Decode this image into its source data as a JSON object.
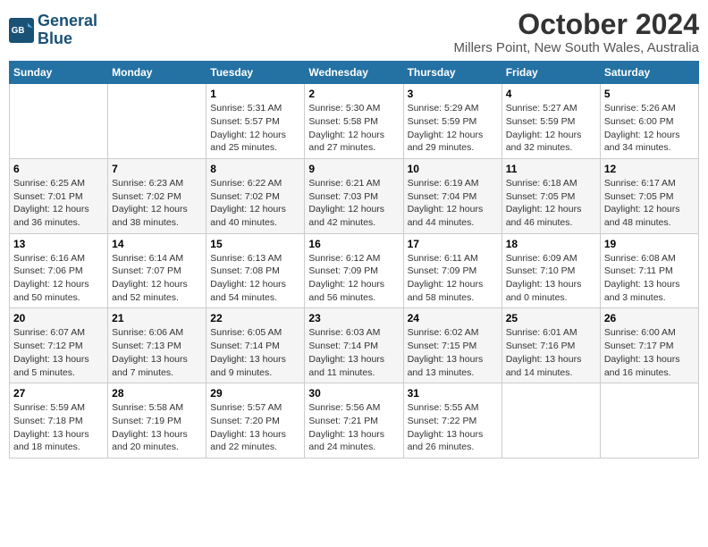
{
  "logo": {
    "line1": "General",
    "line2": "Blue"
  },
  "title": "October 2024",
  "subtitle": "Millers Point, New South Wales, Australia",
  "days_of_week": [
    "Sunday",
    "Monday",
    "Tuesday",
    "Wednesday",
    "Thursday",
    "Friday",
    "Saturday"
  ],
  "weeks": [
    [
      {
        "day": "",
        "sunrise": "",
        "sunset": "",
        "daylight": ""
      },
      {
        "day": "",
        "sunrise": "",
        "sunset": "",
        "daylight": ""
      },
      {
        "day": "1",
        "sunrise": "Sunrise: 5:31 AM",
        "sunset": "Sunset: 5:57 PM",
        "daylight": "Daylight: 12 hours and 25 minutes."
      },
      {
        "day": "2",
        "sunrise": "Sunrise: 5:30 AM",
        "sunset": "Sunset: 5:58 PM",
        "daylight": "Daylight: 12 hours and 27 minutes."
      },
      {
        "day": "3",
        "sunrise": "Sunrise: 5:29 AM",
        "sunset": "Sunset: 5:59 PM",
        "daylight": "Daylight: 12 hours and 29 minutes."
      },
      {
        "day": "4",
        "sunrise": "Sunrise: 5:27 AM",
        "sunset": "Sunset: 5:59 PM",
        "daylight": "Daylight: 12 hours and 32 minutes."
      },
      {
        "day": "5",
        "sunrise": "Sunrise: 5:26 AM",
        "sunset": "Sunset: 6:00 PM",
        "daylight": "Daylight: 12 hours and 34 minutes."
      }
    ],
    [
      {
        "day": "6",
        "sunrise": "Sunrise: 6:25 AM",
        "sunset": "Sunset: 7:01 PM",
        "daylight": "Daylight: 12 hours and 36 minutes."
      },
      {
        "day": "7",
        "sunrise": "Sunrise: 6:23 AM",
        "sunset": "Sunset: 7:02 PM",
        "daylight": "Daylight: 12 hours and 38 minutes."
      },
      {
        "day": "8",
        "sunrise": "Sunrise: 6:22 AM",
        "sunset": "Sunset: 7:02 PM",
        "daylight": "Daylight: 12 hours and 40 minutes."
      },
      {
        "day": "9",
        "sunrise": "Sunrise: 6:21 AM",
        "sunset": "Sunset: 7:03 PM",
        "daylight": "Daylight: 12 hours and 42 minutes."
      },
      {
        "day": "10",
        "sunrise": "Sunrise: 6:19 AM",
        "sunset": "Sunset: 7:04 PM",
        "daylight": "Daylight: 12 hours and 44 minutes."
      },
      {
        "day": "11",
        "sunrise": "Sunrise: 6:18 AM",
        "sunset": "Sunset: 7:05 PM",
        "daylight": "Daylight: 12 hours and 46 minutes."
      },
      {
        "day": "12",
        "sunrise": "Sunrise: 6:17 AM",
        "sunset": "Sunset: 7:05 PM",
        "daylight": "Daylight: 12 hours and 48 minutes."
      }
    ],
    [
      {
        "day": "13",
        "sunrise": "Sunrise: 6:16 AM",
        "sunset": "Sunset: 7:06 PM",
        "daylight": "Daylight: 12 hours and 50 minutes."
      },
      {
        "day": "14",
        "sunrise": "Sunrise: 6:14 AM",
        "sunset": "Sunset: 7:07 PM",
        "daylight": "Daylight: 12 hours and 52 minutes."
      },
      {
        "day": "15",
        "sunrise": "Sunrise: 6:13 AM",
        "sunset": "Sunset: 7:08 PM",
        "daylight": "Daylight: 12 hours and 54 minutes."
      },
      {
        "day": "16",
        "sunrise": "Sunrise: 6:12 AM",
        "sunset": "Sunset: 7:09 PM",
        "daylight": "Daylight: 12 hours and 56 minutes."
      },
      {
        "day": "17",
        "sunrise": "Sunrise: 6:11 AM",
        "sunset": "Sunset: 7:09 PM",
        "daylight": "Daylight: 12 hours and 58 minutes."
      },
      {
        "day": "18",
        "sunrise": "Sunrise: 6:09 AM",
        "sunset": "Sunset: 7:10 PM",
        "daylight": "Daylight: 13 hours and 0 minutes."
      },
      {
        "day": "19",
        "sunrise": "Sunrise: 6:08 AM",
        "sunset": "Sunset: 7:11 PM",
        "daylight": "Daylight: 13 hours and 3 minutes."
      }
    ],
    [
      {
        "day": "20",
        "sunrise": "Sunrise: 6:07 AM",
        "sunset": "Sunset: 7:12 PM",
        "daylight": "Daylight: 13 hours and 5 minutes."
      },
      {
        "day": "21",
        "sunrise": "Sunrise: 6:06 AM",
        "sunset": "Sunset: 7:13 PM",
        "daylight": "Daylight: 13 hours and 7 minutes."
      },
      {
        "day": "22",
        "sunrise": "Sunrise: 6:05 AM",
        "sunset": "Sunset: 7:14 PM",
        "daylight": "Daylight: 13 hours and 9 minutes."
      },
      {
        "day": "23",
        "sunrise": "Sunrise: 6:03 AM",
        "sunset": "Sunset: 7:14 PM",
        "daylight": "Daylight: 13 hours and 11 minutes."
      },
      {
        "day": "24",
        "sunrise": "Sunrise: 6:02 AM",
        "sunset": "Sunset: 7:15 PM",
        "daylight": "Daylight: 13 hours and 13 minutes."
      },
      {
        "day": "25",
        "sunrise": "Sunrise: 6:01 AM",
        "sunset": "Sunset: 7:16 PM",
        "daylight": "Daylight: 13 hours and 14 minutes."
      },
      {
        "day": "26",
        "sunrise": "Sunrise: 6:00 AM",
        "sunset": "Sunset: 7:17 PM",
        "daylight": "Daylight: 13 hours and 16 minutes."
      }
    ],
    [
      {
        "day": "27",
        "sunrise": "Sunrise: 5:59 AM",
        "sunset": "Sunset: 7:18 PM",
        "daylight": "Daylight: 13 hours and 18 minutes."
      },
      {
        "day": "28",
        "sunrise": "Sunrise: 5:58 AM",
        "sunset": "Sunset: 7:19 PM",
        "daylight": "Daylight: 13 hours and 20 minutes."
      },
      {
        "day": "29",
        "sunrise": "Sunrise: 5:57 AM",
        "sunset": "Sunset: 7:20 PM",
        "daylight": "Daylight: 13 hours and 22 minutes."
      },
      {
        "day": "30",
        "sunrise": "Sunrise: 5:56 AM",
        "sunset": "Sunset: 7:21 PM",
        "daylight": "Daylight: 13 hours and 24 minutes."
      },
      {
        "day": "31",
        "sunrise": "Sunrise: 5:55 AM",
        "sunset": "Sunset: 7:22 PM",
        "daylight": "Daylight: 13 hours and 26 minutes."
      },
      {
        "day": "",
        "sunrise": "",
        "sunset": "",
        "daylight": ""
      },
      {
        "day": "",
        "sunrise": "",
        "sunset": "",
        "daylight": ""
      }
    ]
  ]
}
